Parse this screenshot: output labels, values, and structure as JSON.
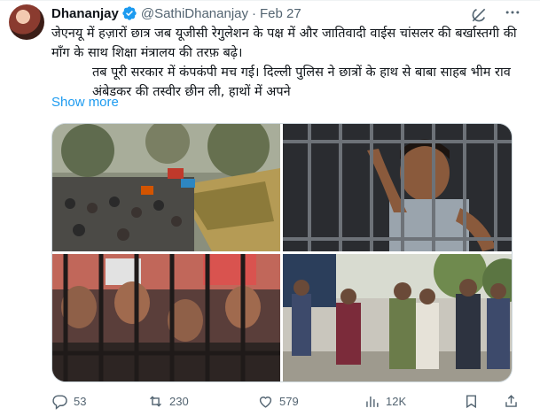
{
  "author": {
    "name": "Dhananjay",
    "handle": "@SathiDhananjay",
    "separator": "·",
    "date": "Feb 27"
  },
  "tweet": {
    "line1": "जेएनयू में हज़ारों छात्र जब यूजीसी रेगुलेशन के पक्ष में और जातिवादी वाईस चांसलर की बर्खास्तगी की माँग के साथ शिक्षा मंत्रालय की तरफ़ बढ़े।",
    "line2": "तब पूरी सरकार में कंपकंपी मच गई। दिल्ली पुलिस ने छात्रों के हाथ से बाबा साहब भीम राव अंबेडकर की तस्वीर छीन ली, हाथों में अपने",
    "show_more": "Show more"
  },
  "metrics": {
    "replies": "53",
    "reposts": "230",
    "likes": "579",
    "views": "12K"
  },
  "icons": {
    "verified": "verified-badge-icon",
    "grok": "grok-icon",
    "more": "more-options-icon",
    "reply": "reply-icon",
    "repost": "repost-icon",
    "like": "like-icon",
    "views": "views-icon",
    "bookmark": "bookmark-icon",
    "share": "share-icon"
  },
  "colors": {
    "accent": "#1d9bf0",
    "text": "#0f1419",
    "muted": "#536471"
  }
}
